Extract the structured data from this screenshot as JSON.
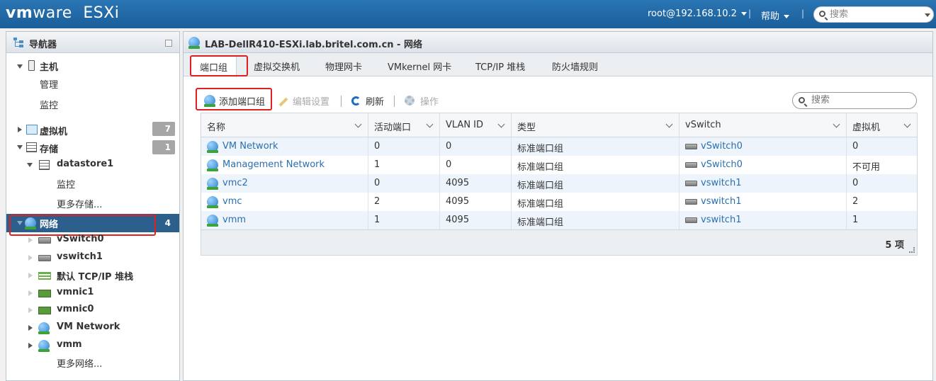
{
  "topbar": {
    "logo_brand": "vm",
    "logo_rest": "ware",
    "logo_product": "ESXi",
    "user": "root@192.168.10.2",
    "help": "帮助",
    "search_placeholder": "搜索"
  },
  "navigator": {
    "title": "导航器",
    "host": "主机",
    "host_manage": "管理",
    "host_monitor": "监控",
    "vms": "虚拟机",
    "vms_count": "7",
    "storage": "存储",
    "storage_count": "1",
    "datastore": "datastore1",
    "datastore_monitor": "监控",
    "more_storage": "更多存储...",
    "network": "网络",
    "network_count": "4",
    "vswitch0": "vSwitch0",
    "vswitch1": "vswitch1",
    "tcpip": "默认 TCP/IP 堆栈",
    "vmnic1": "vmnic1",
    "vmnic0": "vmnic0",
    "vm_network": "VM Network",
    "vmm": "vmm",
    "more_networks": "更多网络..."
  },
  "main": {
    "title": "LAB-DellR410-ESXi.lab.britel.com.cn - 网络",
    "tabs": [
      "端口组",
      "虚拟交换机",
      "物理网卡",
      "VMkernel 网卡",
      "TCP/IP 堆栈",
      "防火墙规则"
    ],
    "toolbar": {
      "add": "添加端口组",
      "edit": "编辑设置",
      "refresh": "刷新",
      "actions": "操作"
    },
    "search_placeholder": "搜索",
    "columns": [
      "名称",
      "活动端口",
      "VLAN ID",
      "类型",
      "vSwitch",
      "虚拟机"
    ],
    "rows": [
      [
        "VM Network",
        "0",
        "0",
        "标准端口组",
        "vSwitch0",
        "0"
      ],
      [
        "Management Network",
        "1",
        "0",
        "标准端口组",
        "vSwitch0",
        "不可用"
      ],
      [
        "vmc2",
        "0",
        "4095",
        "标准端口组",
        "vswitch1",
        "0"
      ],
      [
        "vmc",
        "2",
        "4095",
        "标准端口组",
        "vswitch1",
        "2"
      ],
      [
        "vmm",
        "1",
        "4095",
        "标准端口组",
        "vswitch1",
        "1"
      ]
    ],
    "item_count": "5 项"
  },
  "colors": {
    "topbar": "#1f6aa8",
    "selected_nav": "#2d5f8d",
    "highlight": "#e02020",
    "link": "#2a6fb0"
  }
}
